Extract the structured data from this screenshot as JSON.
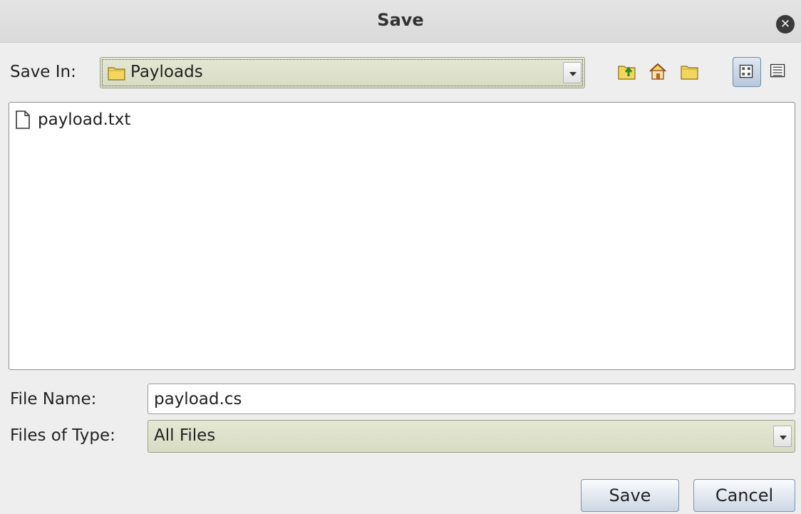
{
  "dialog": {
    "title": "Save",
    "close_icon": "close-icon"
  },
  "save_in": {
    "label": "Save In:",
    "folder": "Payloads",
    "icons": [
      "up-folder-icon",
      "home-icon",
      "new-folder-icon",
      "list-view-icon",
      "details-view-icon"
    ]
  },
  "files": [
    {
      "name": "payload.txt",
      "icon": "document-icon"
    }
  ],
  "file_name": {
    "label": "File Name:",
    "value": "payload.cs"
  },
  "file_type": {
    "label": "Files of Type:",
    "value": "All Files"
  },
  "buttons": {
    "save": "Save",
    "cancel": "Cancel"
  },
  "colors": {
    "combo_bg": "#dde1c9",
    "button_bg": "#dfe6ef",
    "folder_yellow": "#f2d35a"
  }
}
